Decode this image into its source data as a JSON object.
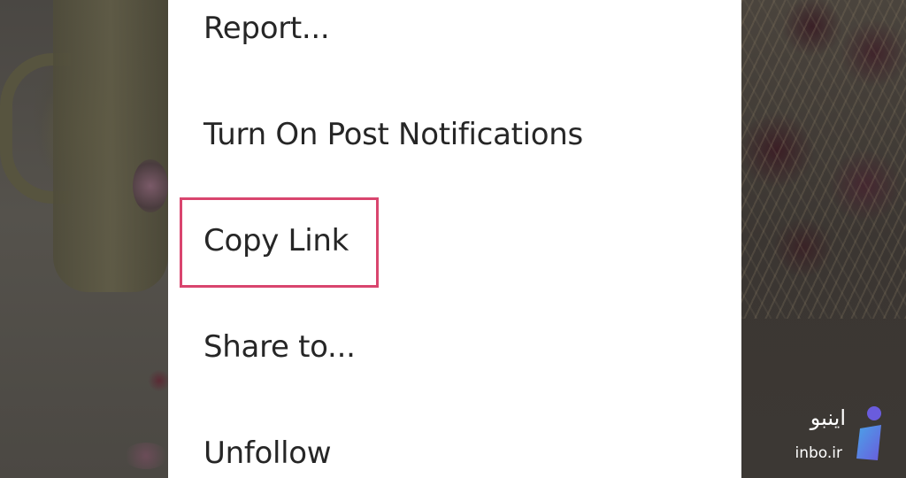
{
  "menu": {
    "items": [
      {
        "label": "Report..."
      },
      {
        "label": "Turn On Post Notifications"
      },
      {
        "label": "Copy Link"
      },
      {
        "label": "Share to..."
      },
      {
        "label": "Unfollow"
      }
    ],
    "highlighted_item": "Copy Link",
    "highlight_color": "#d9456e"
  },
  "watermark": {
    "brand_fa": "اینبو",
    "domain": "inbo.ir",
    "logo_icon": "inbo-logo-icon",
    "logo_colors": [
      "#4aa3e8",
      "#6a5cdd"
    ]
  },
  "colors": {
    "menu_background": "#ffffff",
    "menu_text": "#262626"
  }
}
